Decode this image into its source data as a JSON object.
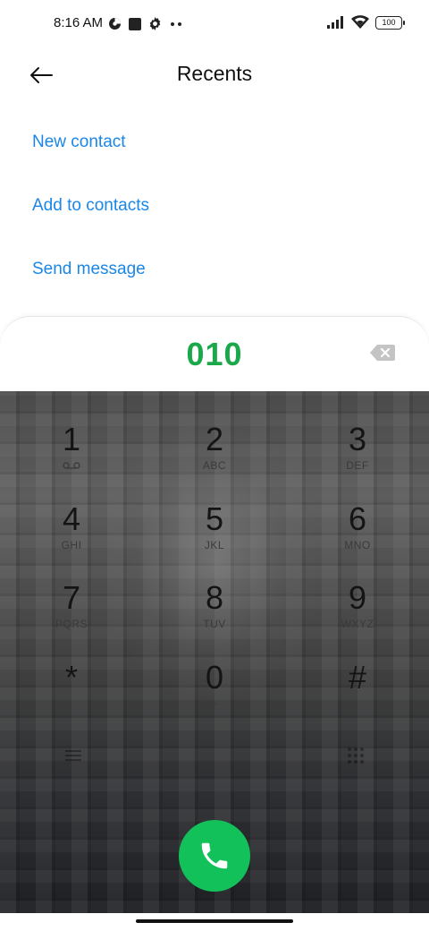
{
  "status_bar": {
    "time": "8:16 AM",
    "battery": "100",
    "icons": [
      "data-saver-icon",
      "square-notification-icon",
      "gear-icon",
      "more-dots-icon",
      "signal-icon",
      "wifi-icon",
      "battery-icon"
    ]
  },
  "header": {
    "title": "Recents",
    "back_icon": "back-arrow-icon"
  },
  "actions": [
    {
      "label": "New contact"
    },
    {
      "label": "Add to contacts"
    },
    {
      "label": "Send message"
    }
  ],
  "dialer": {
    "number": "010",
    "backspace_icon": "backspace-icon"
  },
  "keypad": {
    "keys": [
      {
        "digit": "1",
        "letters": "voicemail-icon"
      },
      {
        "digit": "2",
        "letters": "ABC"
      },
      {
        "digit": "3",
        "letters": "DEF"
      },
      {
        "digit": "4",
        "letters": "GHI"
      },
      {
        "digit": "5",
        "letters": "JKL"
      },
      {
        "digit": "6",
        "letters": "MNO"
      },
      {
        "digit": "7",
        "letters": "PQRS"
      },
      {
        "digit": "8",
        "letters": "TUV"
      },
      {
        "digit": "9",
        "letters": "WXYZ"
      },
      {
        "digit": "*",
        "letters": ","
      },
      {
        "digit": "0",
        "letters": "+"
      },
      {
        "digit": "#",
        "letters": ""
      }
    ]
  },
  "call_button": {
    "icon": "phone-icon",
    "color": "#13c15a"
  },
  "colors": {
    "accent_blue": "#1a86e6",
    "number_green": "#1ba84a"
  }
}
